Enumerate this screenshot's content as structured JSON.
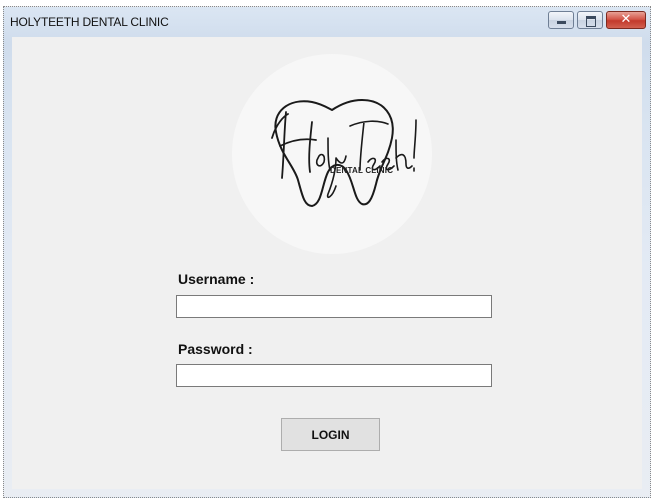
{
  "window": {
    "title": "HOLYTEETH DENTAL CLINIC",
    "controls": {
      "minimize_icon": "minimize-icon",
      "maximize_icon": "maximize-icon",
      "close_icon": "close-icon",
      "close_glyph": "✕"
    }
  },
  "logo": {
    "wordmark": "HolyTeeth!",
    "subtitle": "DENTAL CLINIC"
  },
  "form": {
    "username_label": "Username :",
    "username_value": "",
    "password_label": "Password :",
    "password_value": "",
    "login_label": "LOGIN"
  },
  "colors": {
    "client_background": "#f0f0f0",
    "close_button": "#c23a2c",
    "button_face": "#e1e1e1"
  }
}
